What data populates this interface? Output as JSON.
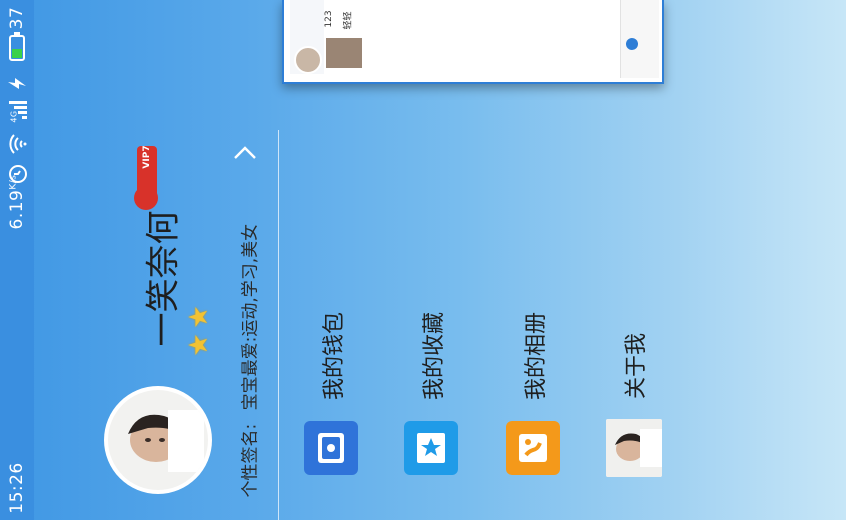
{
  "status_bar": {
    "time": "15:26",
    "speed": "6.19",
    "speed_unit": "K/s",
    "network": "4G",
    "battery": "37"
  },
  "profile": {
    "username": "一笑奈何",
    "vip_label": "VIP7",
    "signature_label": "个性签名:",
    "signature_text": "宝宝最爱:运动,学习,美女"
  },
  "menu": [
    {
      "label": "我的钱包",
      "icon": "wallet-icon",
      "color": "#2f73d9"
    },
    {
      "label": "我的收藏",
      "icon": "star-collection-icon",
      "color": "#1f9be8"
    },
    {
      "label": "我的相册",
      "icon": "album-icon",
      "color": "#f4991a"
    },
    {
      "label": "关于我",
      "icon": "about-avatar-icon",
      "color": "#e8e8e8"
    }
  ],
  "preview_card": {
    "line1": "123",
    "line2": "轻轻"
  },
  "colors": {
    "accent": "#3a8fe0",
    "vip": "#d8322a",
    "star": "#f2c233"
  }
}
